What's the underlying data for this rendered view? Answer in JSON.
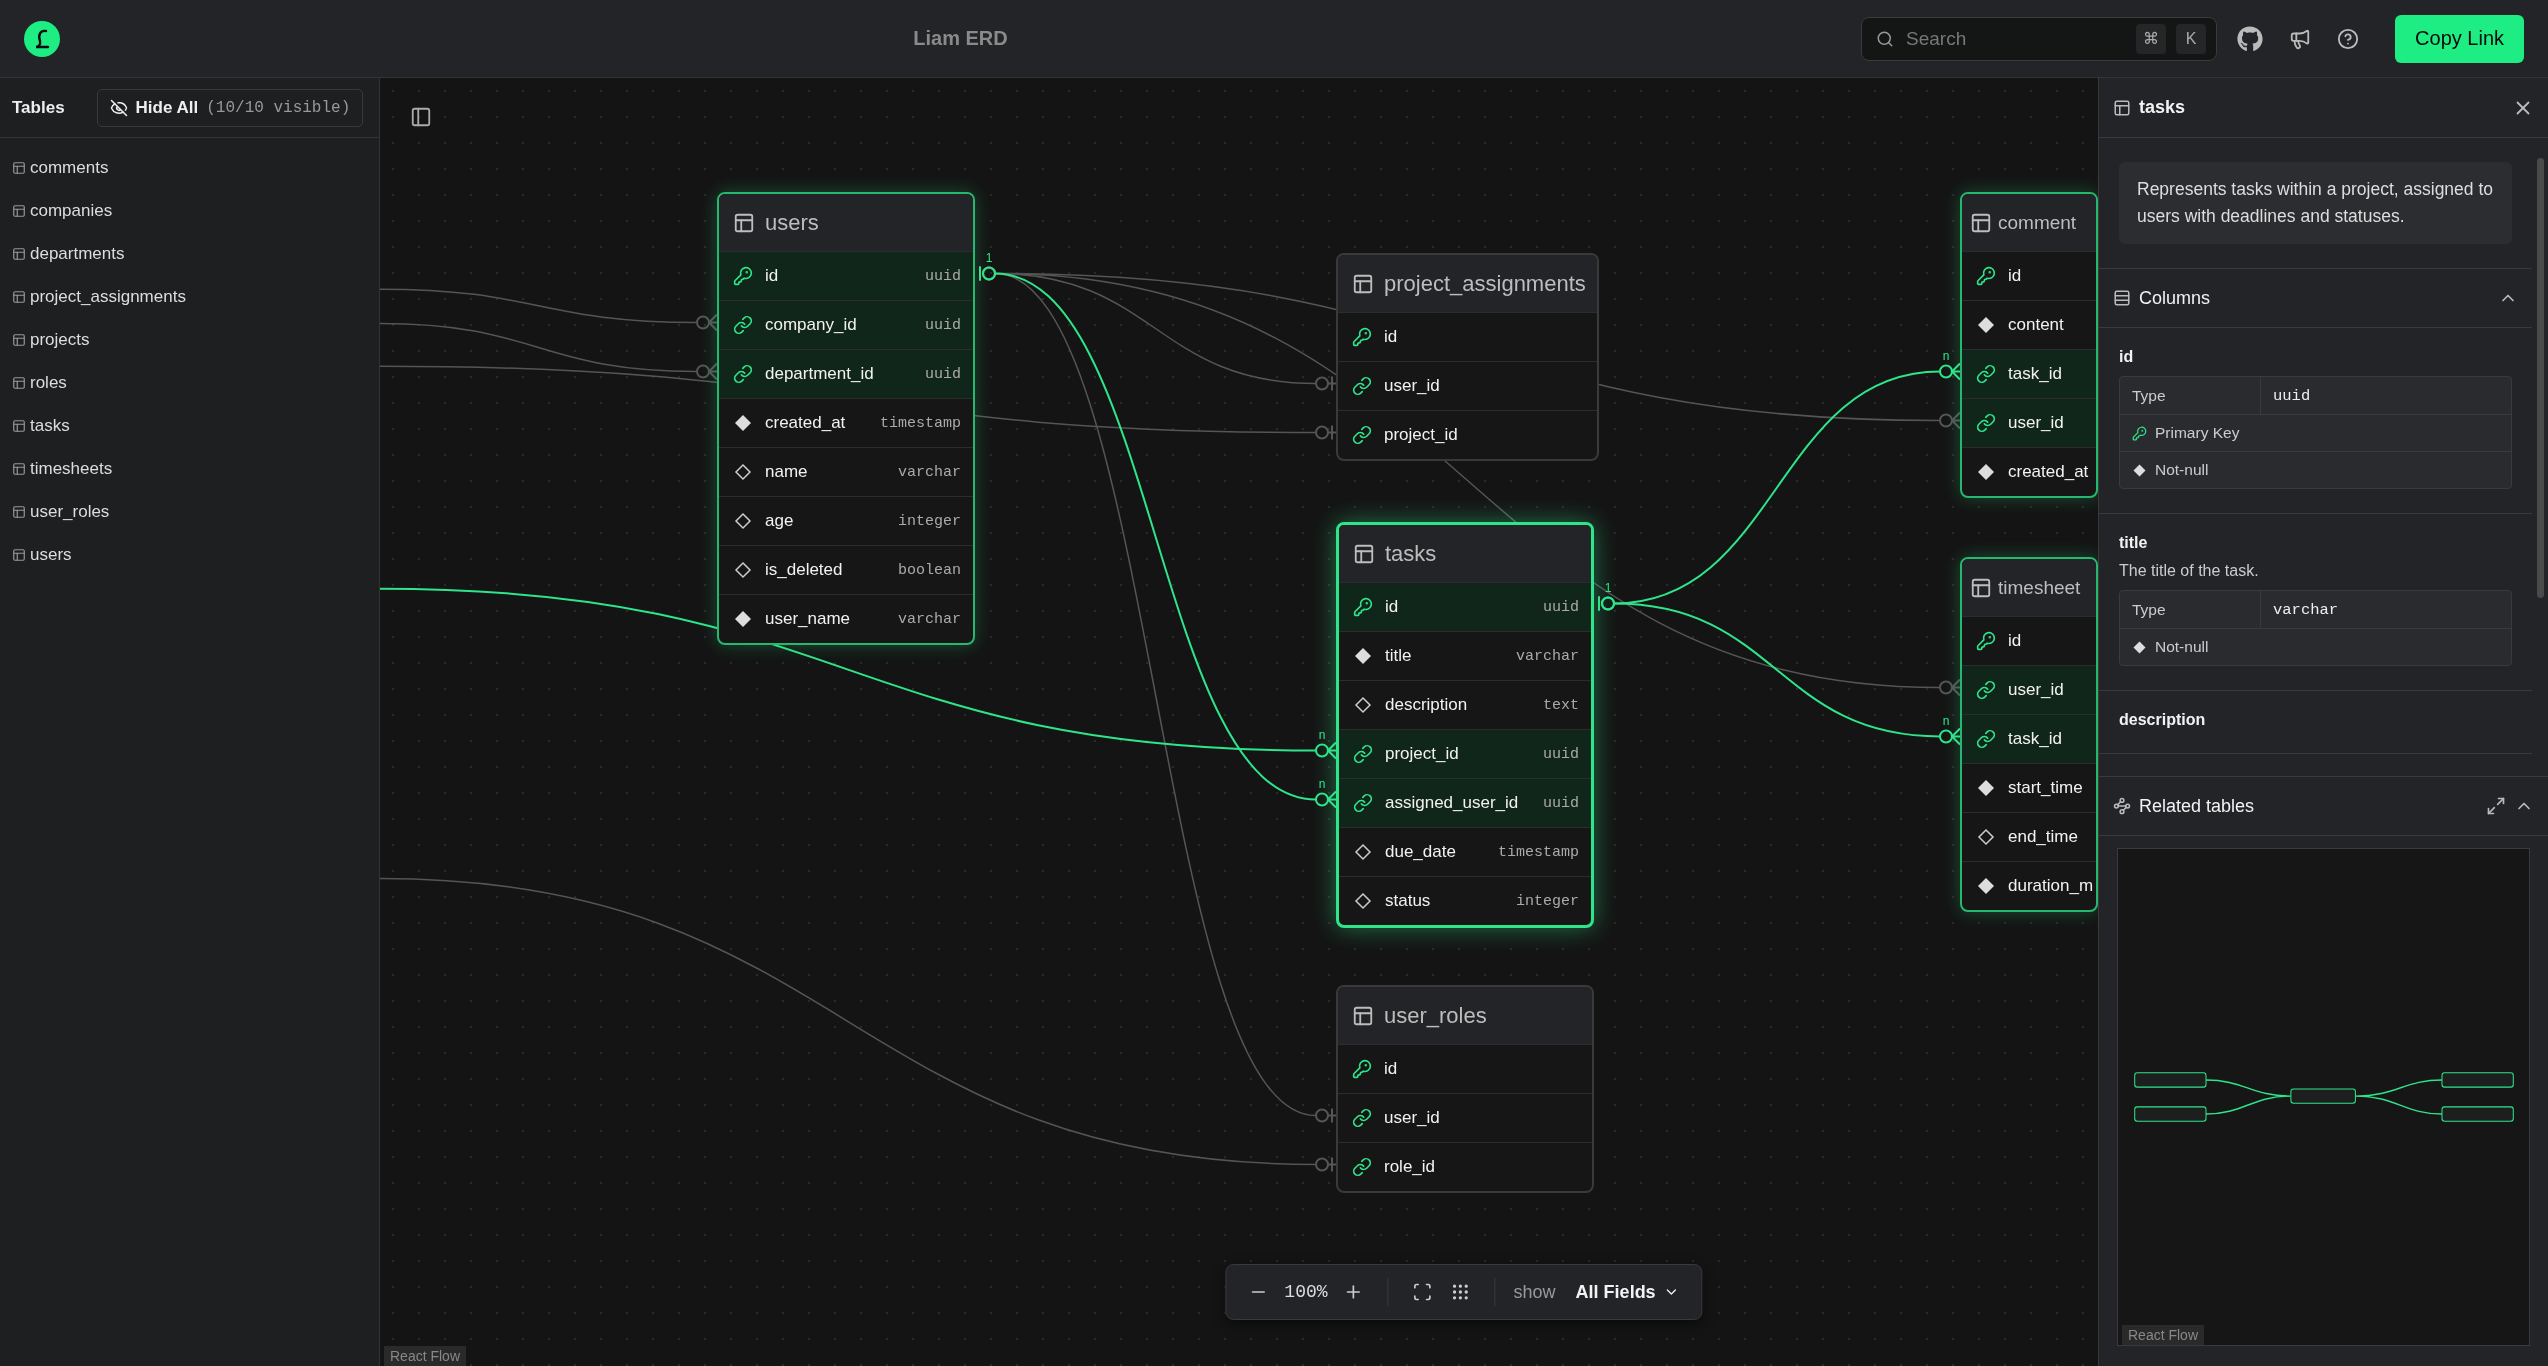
{
  "app": {
    "title": "Liam ERD",
    "search": {
      "placeholder": "Search",
      "keys": [
        "⌘",
        "K"
      ]
    },
    "copy_button": "Copy Link"
  },
  "sidebar": {
    "title": "Tables",
    "hide_all": {
      "label": "Hide All",
      "count": "(10/10 visible)"
    },
    "items": [
      "comments",
      "companies",
      "departments",
      "project_assignments",
      "projects",
      "roles",
      "tasks",
      "timesheets",
      "user_roles",
      "users"
    ]
  },
  "canvas": {
    "nodes": [
      {
        "name": "users",
        "highlighted": true,
        "selected": false,
        "columns": [
          {
            "name": "id",
            "type": "uuid",
            "kind": "primary_key",
            "highlighted": true
          },
          {
            "name": "company_id",
            "type": "uuid",
            "kind": "foreign_key",
            "highlighted": true
          },
          {
            "name": "department_id",
            "type": "uuid",
            "kind": "foreign_key",
            "highlighted": true
          },
          {
            "name": "created_at",
            "type": "timestamp",
            "kind": "not_null",
            "highlighted": false
          },
          {
            "name": "name",
            "type": "varchar",
            "kind": "nullable",
            "highlighted": false
          },
          {
            "name": "age",
            "type": "integer",
            "kind": "nullable",
            "highlighted": false
          },
          {
            "name": "is_deleted",
            "type": "boolean",
            "kind": "nullable",
            "highlighted": false
          },
          {
            "name": "user_name",
            "type": "varchar",
            "kind": "not_null",
            "highlighted": false
          }
        ]
      },
      {
        "name": "project_assignments",
        "highlighted": false,
        "selected": false,
        "columns": [
          {
            "name": "id",
            "kind": "primary_key",
            "highlighted": false
          },
          {
            "name": "user_id",
            "kind": "foreign_key",
            "highlighted": false
          },
          {
            "name": "project_id",
            "kind": "foreign_key",
            "highlighted": false
          }
        ]
      },
      {
        "name": "tasks",
        "highlighted": true,
        "selected": true,
        "columns": [
          {
            "name": "id",
            "type": "uuid",
            "kind": "primary_key",
            "highlighted": true
          },
          {
            "name": "title",
            "type": "varchar",
            "kind": "not_null",
            "highlighted": false
          },
          {
            "name": "description",
            "type": "text",
            "kind": "nullable",
            "highlighted": false
          },
          {
            "name": "project_id",
            "type": "uuid",
            "kind": "foreign_key",
            "highlighted": true
          },
          {
            "name": "assigned_user_id",
            "type": "uuid",
            "kind": "foreign_key",
            "highlighted": true
          },
          {
            "name": "due_date",
            "type": "timestamp",
            "kind": "nullable",
            "highlighted": false
          },
          {
            "name": "status",
            "type": "integer",
            "kind": "nullable",
            "highlighted": false
          }
        ]
      },
      {
        "name": "user_roles",
        "highlighted": false,
        "selected": false,
        "columns": [
          {
            "name": "id",
            "kind": "primary_key",
            "highlighted": false
          },
          {
            "name": "user_id",
            "kind": "foreign_key",
            "highlighted": false
          },
          {
            "name": "role_id",
            "kind": "foreign_key",
            "highlighted": false
          }
        ]
      },
      {
        "name": "comment",
        "highlighted": true,
        "selected": false,
        "columns": [
          {
            "name": "id",
            "kind": "primary_key",
            "highlighted": false
          },
          {
            "name": "content",
            "kind": "not_null",
            "highlighted": false
          },
          {
            "name": "task_id",
            "kind": "foreign_key",
            "highlighted": true
          },
          {
            "name": "user_id",
            "kind": "foreign_key",
            "highlighted": true
          },
          {
            "name": "created_at",
            "kind": "not_null",
            "highlighted": false
          }
        ]
      },
      {
        "name": "timesheet",
        "highlighted": true,
        "selected": false,
        "columns": [
          {
            "name": "id",
            "kind": "primary_key",
            "highlighted": false
          },
          {
            "name": "user_id",
            "kind": "foreign_key",
            "highlighted": true
          },
          {
            "name": "task_id",
            "kind": "foreign_key",
            "highlighted": true
          },
          {
            "name": "start_time",
            "kind": "not_null",
            "highlighted": false
          },
          {
            "name": "end_time",
            "kind": "nullable",
            "highlighted": false
          },
          {
            "name": "duration_m",
            "kind": "not_null",
            "highlighted": false
          }
        ]
      }
    ],
    "edges": [
      {
        "highlighted": false
      },
      {
        "highlighted": false
      },
      {
        "highlighted": false
      },
      {
        "highlighted": false
      },
      {
        "highlighted": false
      },
      {
        "highlighted": false
      },
      {
        "highlighted": false
      },
      {
        "highlighted": false
      },
      {
        "highlighted": true,
        "source_label": "1",
        "target_label": "n"
      },
      {
        "highlighted": true,
        "target_label": "n"
      },
      {
        "highlighted": true,
        "source_label": "1",
        "target_label": "n"
      },
      {
        "highlighted": true,
        "target_label": "n"
      }
    ],
    "attribution": "React Flow"
  },
  "toolbar": {
    "zoom": "100%",
    "show_label": "show",
    "show_value": "All Fields"
  },
  "detail_panel": {
    "title": "tasks",
    "description": "Represents tasks within a project, assigned to users with deadlines and statuses.",
    "columns_title": "Columns",
    "columns_expanded": true,
    "columns": [
      {
        "name": "id",
        "rows": [
          {
            "kind": "type",
            "label": "Type",
            "value": "uuid"
          },
          {
            "kind": "primary_key",
            "label": "Primary Key"
          },
          {
            "kind": "not_null",
            "label": "Not-null"
          }
        ]
      },
      {
        "name": "title",
        "comment": "The title of the task.",
        "rows": [
          {
            "kind": "type",
            "label": "Type",
            "value": "varchar"
          },
          {
            "kind": "not_null",
            "label": "Not-null"
          }
        ]
      },
      {
        "name": "description"
      }
    ],
    "related": {
      "title": "Related tables",
      "expanded": true,
      "attribution": "React Flow"
    }
  }
}
